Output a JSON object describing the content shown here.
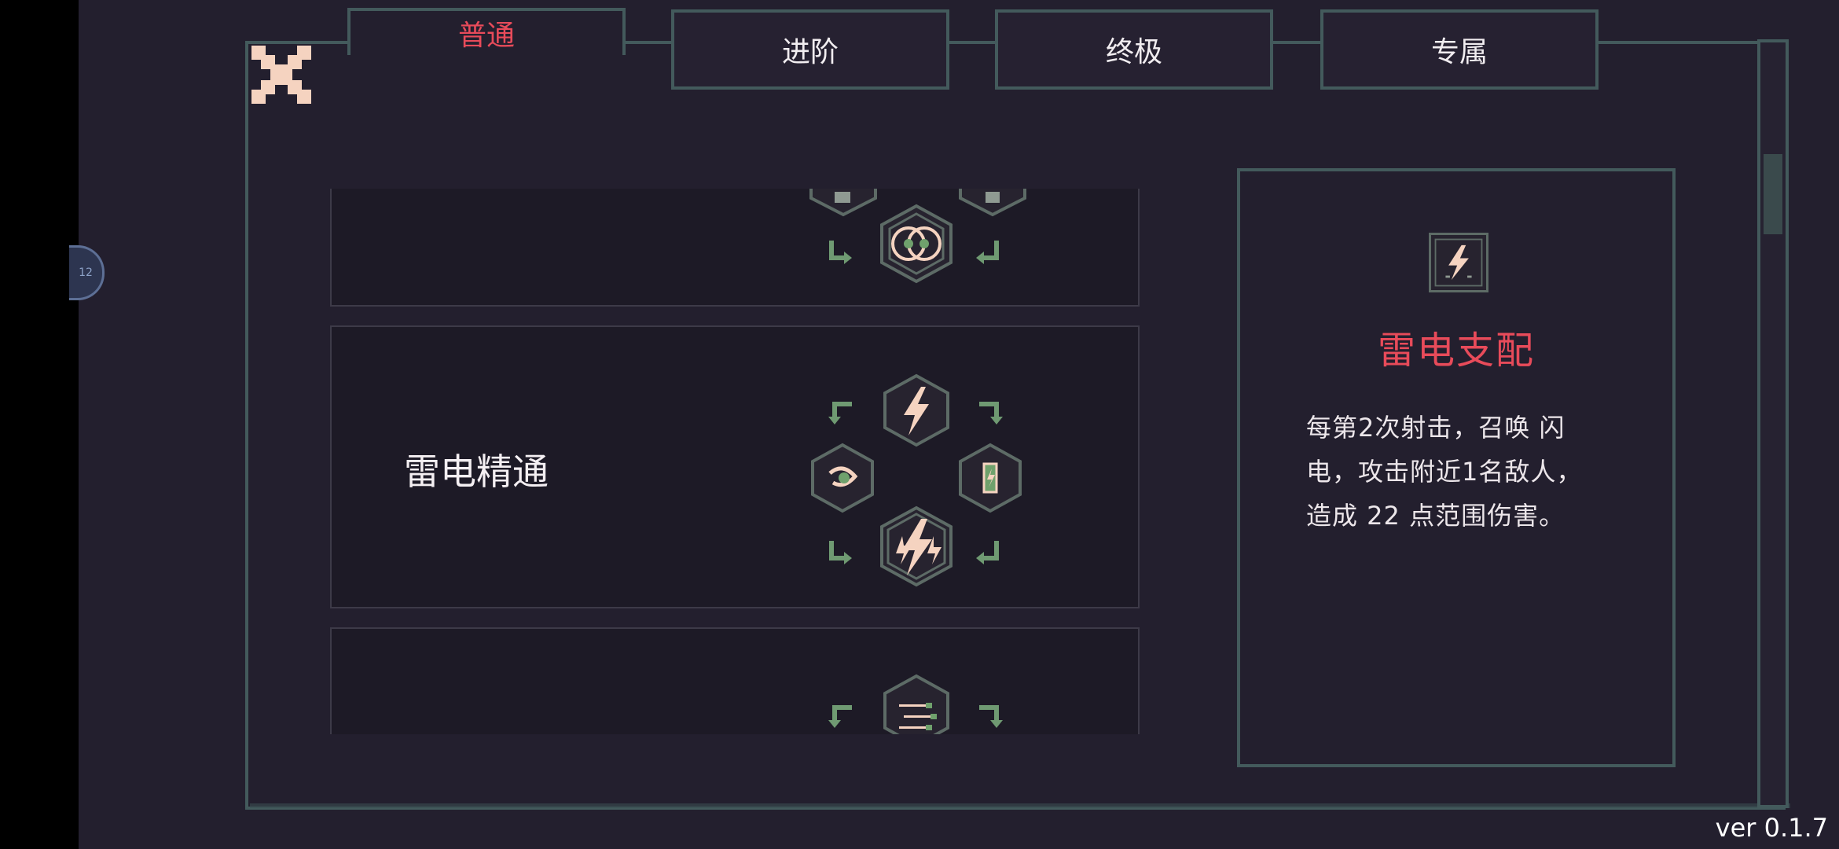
{
  "tabs": [
    {
      "label": "普通",
      "active": true
    },
    {
      "label": "进阶",
      "active": false
    },
    {
      "label": "终极",
      "active": false
    },
    {
      "label": "专属",
      "active": false
    }
  ],
  "side_badge": {
    "text": "12"
  },
  "skill_cards": [
    {
      "title": ""
    },
    {
      "title": "雷电精通"
    },
    {
      "title": ""
    }
  ],
  "detail": {
    "icon": "lightning-icon",
    "title": "雷电支配",
    "description_lines": [
      "每第2次射击，召唤 闪",
      "电，攻击附近1名敌人，",
      "造成 22 点范围伤害。"
    ]
  },
  "version": "ver 0.1.7",
  "colors": {
    "accent": "#e84b5a",
    "frame": "#435a5c",
    "background": "#231f2e",
    "hex_icon": "#5d6b66",
    "icon_fill": "#f5d3c0"
  }
}
